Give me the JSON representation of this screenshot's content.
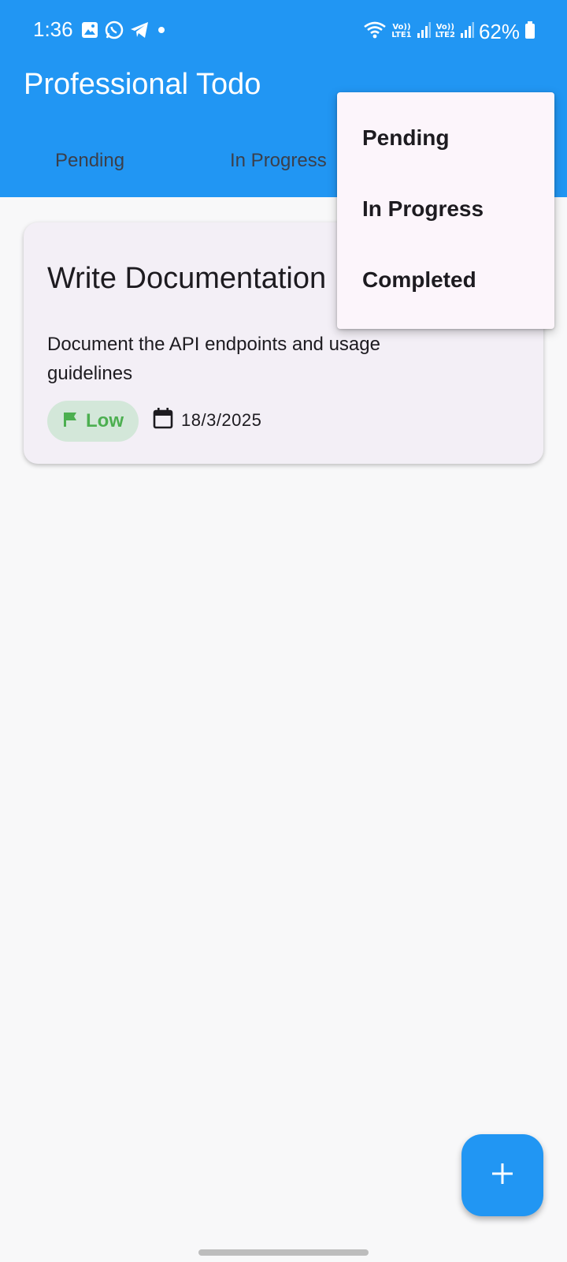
{
  "status_bar": {
    "time": "1:36",
    "battery": "62%",
    "sim1_label_top": "Vo))",
    "sim1_label_bottom": "LTE1",
    "sim2_label_top": "Vo))",
    "sim2_label_bottom": "LTE2",
    "left_icons": [
      "gallery-icon",
      "whatsapp-icon",
      "telegram-icon",
      "notification-dot-icon"
    ],
    "right_icons": [
      "wifi-icon",
      "signal-icon",
      "signal-icon",
      "battery-icon"
    ]
  },
  "app": {
    "title": "Professional Todo",
    "header_color": "#2196F3"
  },
  "tabs": [
    {
      "label": "Pending"
    },
    {
      "label": "In Progress"
    }
  ],
  "tasks": [
    {
      "title": "Write Documentation",
      "description": "Document the API endpoints and usage guidelines",
      "priority": "Low",
      "priority_color": "#4CAF50",
      "priority_icon": "flag-icon",
      "due_date": "18/3/2025",
      "date_icon": "calendar-icon"
    }
  ],
  "dropdown_menu": {
    "items": [
      {
        "label": "Pending"
      },
      {
        "label": "In Progress"
      },
      {
        "label": "Completed"
      }
    ]
  },
  "fab": {
    "icon": "plus-icon",
    "color": "#2196F3"
  }
}
